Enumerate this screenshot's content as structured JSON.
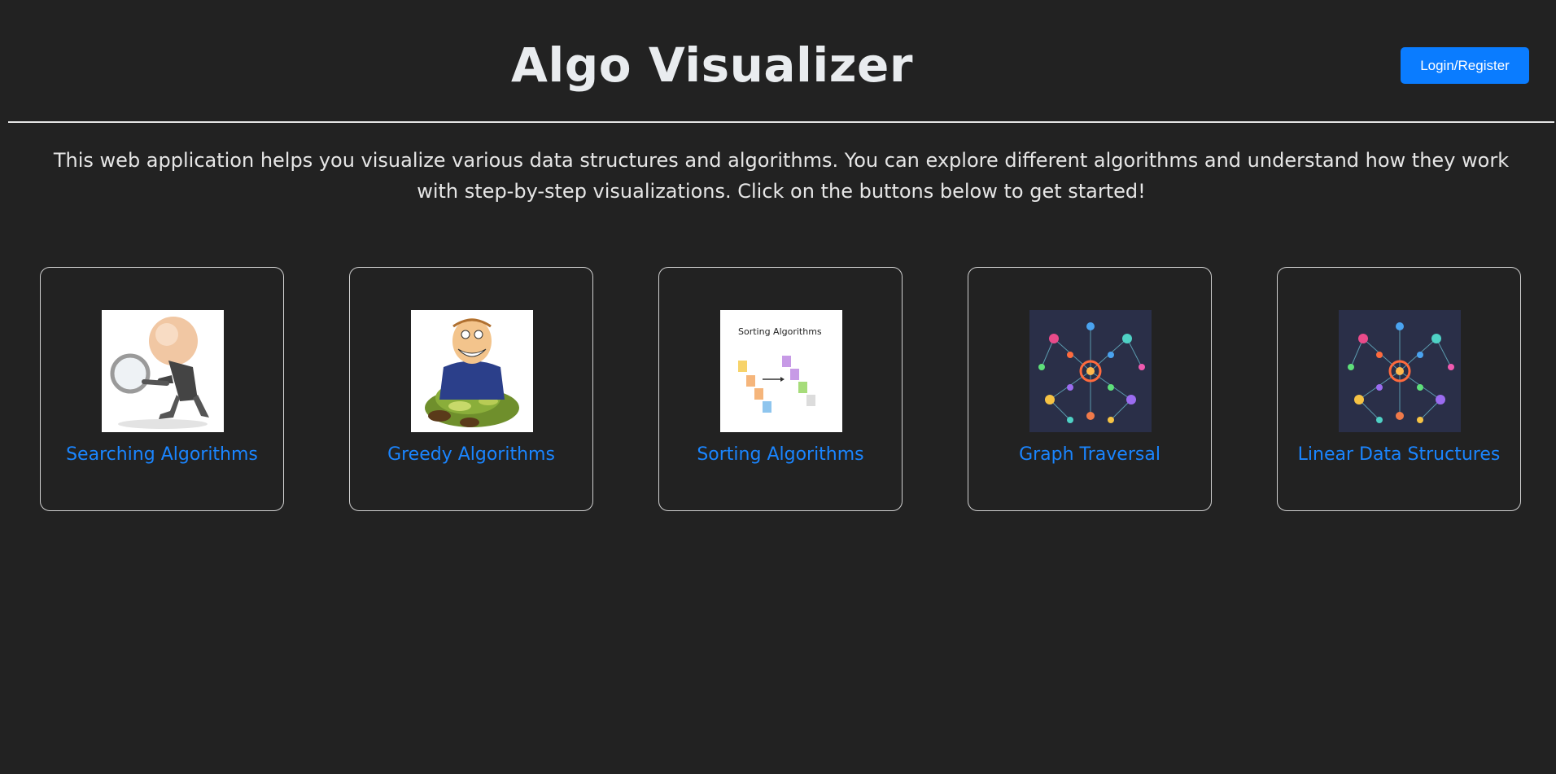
{
  "header": {
    "title": "Algo Visualizer",
    "login_label": "Login/Register"
  },
  "intro": "This web application helps you visualize various data structures and algorithms. You can explore different algorithms and understand how they work with step-by-step visualizations. Click on the buttons below to get started!",
  "cards": [
    {
      "label": "Searching Algorithms",
      "icon": "magnifier-person-image"
    },
    {
      "label": "Greedy Algorithms",
      "icon": "money-pile-man-image"
    },
    {
      "label": "Sorting Algorithms",
      "icon": "sorting-blocks-image",
      "image_text": "Sorting Algorithms"
    },
    {
      "label": "Graph Traversal",
      "icon": "network-graph-image"
    },
    {
      "label": "Linear Data Structures",
      "icon": "network-graph-image"
    }
  ],
  "colors": {
    "background": "#222222",
    "accent": "#0a7cff",
    "link": "#1a85ff"
  }
}
